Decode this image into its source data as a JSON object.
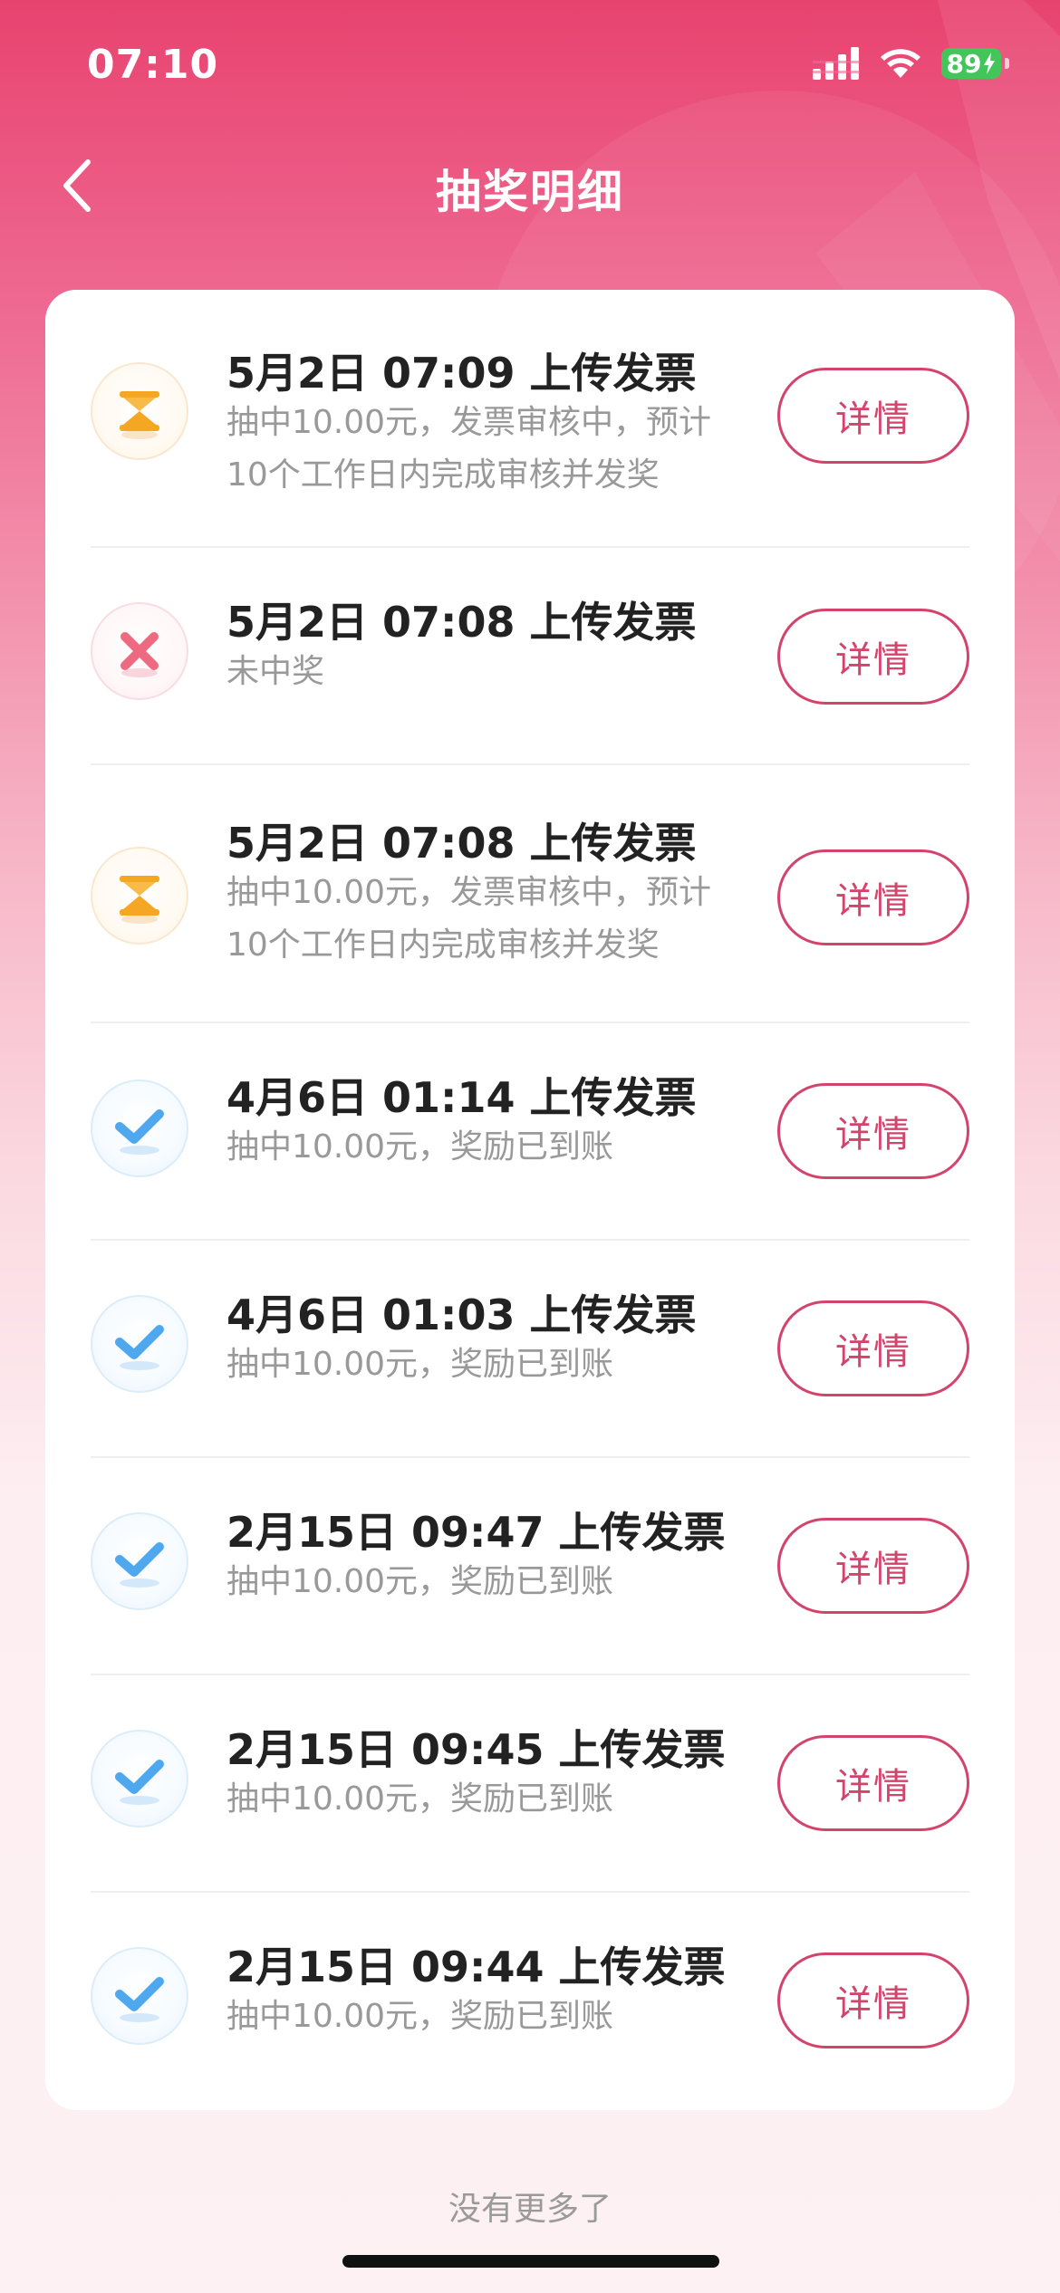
{
  "status_bar": {
    "time": "07:10",
    "battery": "89",
    "signal_icon": "cellular-signal-icon",
    "wifi_icon": "wifi-icon",
    "battery_icon": "battery-charging-icon"
  },
  "nav": {
    "title": "抽奖明细",
    "back_icon": "chevron-left-icon"
  },
  "records": [
    {
      "status": "pending",
      "icon": "hourglass-icon",
      "title": "5月2日 07:09 上传发票",
      "desc": "抽中10.00元，发票审核中，预计10个工作日内完成审核并发奖",
      "button": "详情"
    },
    {
      "status": "failed",
      "icon": "cross-icon",
      "title": "5月2日 07:08 上传发票",
      "desc": "未中奖",
      "button": "详情"
    },
    {
      "status": "pending",
      "icon": "hourglass-icon",
      "title": "5月2日 07:08 上传发票",
      "desc": "抽中10.00元，发票审核中，预计10个工作日内完成审核并发奖",
      "button": "详情"
    },
    {
      "status": "success",
      "icon": "checkmark-icon",
      "title": "4月6日 01:14 上传发票",
      "desc": "抽中10.00元，奖励已到账",
      "button": "详情"
    },
    {
      "status": "success",
      "icon": "checkmark-icon",
      "title": "4月6日 01:03 上传发票",
      "desc": "抽中10.00元，奖励已到账",
      "button": "详情"
    },
    {
      "status": "success",
      "icon": "checkmark-icon",
      "title": "2月15日 09:47 上传发票",
      "desc": "抽中10.00元，奖励已到账",
      "button": "详情"
    },
    {
      "status": "success",
      "icon": "checkmark-icon",
      "title": "2月15日 09:45 上传发票",
      "desc": "抽中10.00元，奖励已到账",
      "button": "详情"
    },
    {
      "status": "success",
      "icon": "checkmark-icon",
      "title": "2月15日 09:44 上传发票",
      "desc": "抽中10.00元，奖励已到账",
      "button": "详情"
    }
  ],
  "footer": {
    "text": "没有更多了"
  },
  "colors": {
    "accent": "#d4436b",
    "header_top": "#e8436f",
    "pending": "#f5a623",
    "failed": "#ee6a80",
    "success": "#4fa8ee"
  }
}
